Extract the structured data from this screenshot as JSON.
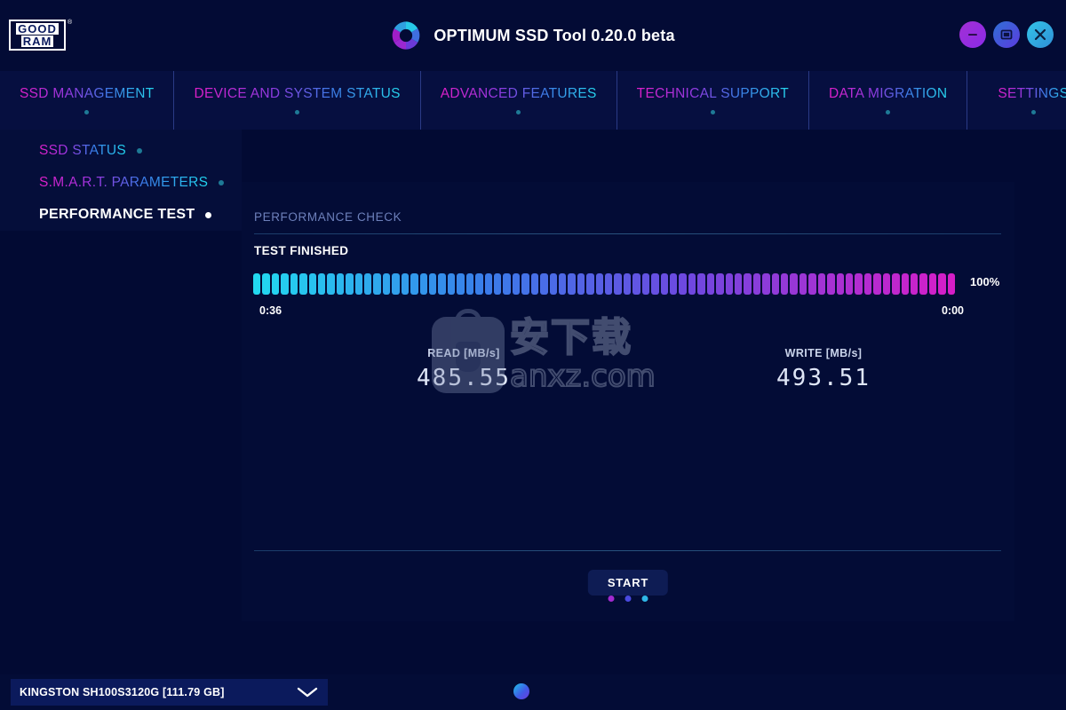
{
  "window": {
    "brand_logo": {
      "line1": "GOOD",
      "line2": "RAM",
      "tm": "®"
    },
    "app_icon": "pinwheel-logo-icon",
    "title": "OPTIMUM SSD Tool 0.20.0 beta",
    "controls": [
      {
        "name": "minimize-button",
        "glyph": "minimize-icon"
      },
      {
        "name": "maximize-button",
        "glyph": "maximize-icon"
      },
      {
        "name": "close-button",
        "glyph": "close-icon"
      }
    ]
  },
  "nav": {
    "tabs": [
      {
        "label": "SSD MANAGEMENT",
        "active": true
      },
      {
        "label": "DEVICE AND SYSTEM STATUS",
        "active": false
      },
      {
        "label": "ADVANCED FEATURES",
        "active": false
      },
      {
        "label": "TECHNICAL SUPPORT",
        "active": false
      },
      {
        "label": "DATA MIGRATION",
        "active": false
      },
      {
        "label": "SETTINGS",
        "active": false
      }
    ]
  },
  "sidebar": {
    "items": [
      {
        "label": "SSD STATUS",
        "active": false
      },
      {
        "label": "S.M.A.R.T. PARAMETERS",
        "active": false
      },
      {
        "label": "PERFORMANCE TEST",
        "active": true
      }
    ]
  },
  "panel": {
    "title": "PERFORMANCE CHECK",
    "status": "TEST FINISHED",
    "progress_percent": "100%",
    "progress_value": 100,
    "elapsed_time": "0:36",
    "remaining_time": "0:00",
    "read": {
      "label": "READ [MB/s]",
      "value": "485.55"
    },
    "write": {
      "label": "WRITE [MB/s]",
      "value": "493.51"
    },
    "start_button": "START",
    "pager_dots": [
      "#a22ad0",
      "#4a4ae0",
      "#2fb7e8"
    ]
  },
  "watermark": {
    "cn_text": "安下载",
    "url_text": "anxz.com"
  },
  "bottom": {
    "drive": "KINGSTON SH100S3120G [111.79 GB]",
    "chevron": "chevron-down-icon",
    "status_indicator": "status-orb-icon"
  },
  "colors": {
    "accent_magenta": "#e01ec8",
    "accent_purple": "#8f3ae0",
    "accent_blue": "#3f7ae8",
    "accent_cyan": "#25d7ef",
    "bg_deep": "#020a33",
    "bg_panel": "#030c36"
  }
}
